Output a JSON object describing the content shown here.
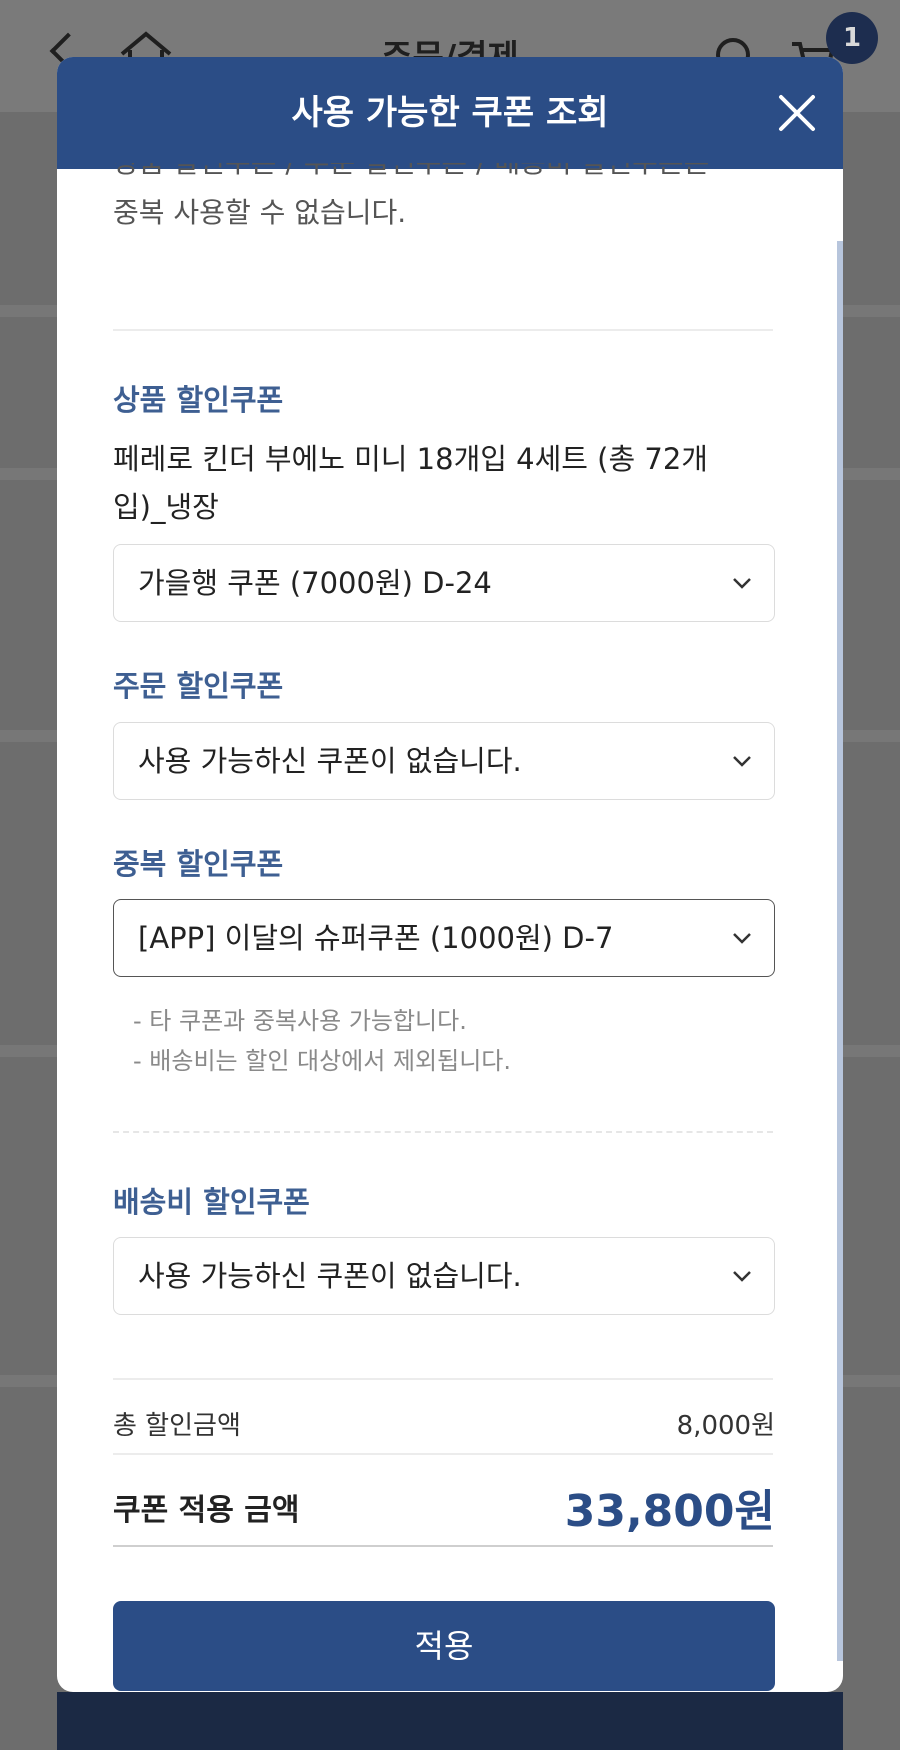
{
  "background": {
    "page_title": "주문/결제",
    "cart_count": "1"
  },
  "modal": {
    "title": "사용 가능한 쿠폰 조회",
    "notice_partial": "상품 할인쿠폰 / 주문 할인쿠폰 / 배송비 할인쿠폰은",
    "notice_line2": "중복 사용할 수 없습니다.",
    "product_coupon": {
      "label": "상품 할인쿠폰",
      "product_name": "페레로 킨더 부에노 미니 18개입 4세트 (총 72개입)_냉장",
      "selected": "가을행 쿠폰 (7000원) D-24"
    },
    "order_coupon": {
      "label": "주문 할인쿠폰",
      "selected": "사용 가능하신 쿠폰이 없습니다."
    },
    "duplicate_coupon": {
      "label": "중복 할인쿠폰",
      "selected": "[APP] 이달의 슈퍼쿠폰 (1000원) D-7",
      "help": [
        "- 타 쿠폰과 중복사용 가능합니다.",
        "- 배송비는 할인 대상에서 제외됩니다."
      ]
    },
    "shipping_coupon": {
      "label": "배송비 할인쿠폰",
      "selected": "사용 가능하신 쿠폰이 없습니다."
    },
    "summary": {
      "total_discount_label": "총 할인금액",
      "total_discount_value": "8,000원",
      "applied_label": "쿠폰 적용 금액",
      "applied_value": "33,800원"
    },
    "apply_label": "적용"
  },
  "colors": {
    "primary": "#2b4d86",
    "label": "#3e5f92",
    "overlay": "#6d6d6d"
  }
}
